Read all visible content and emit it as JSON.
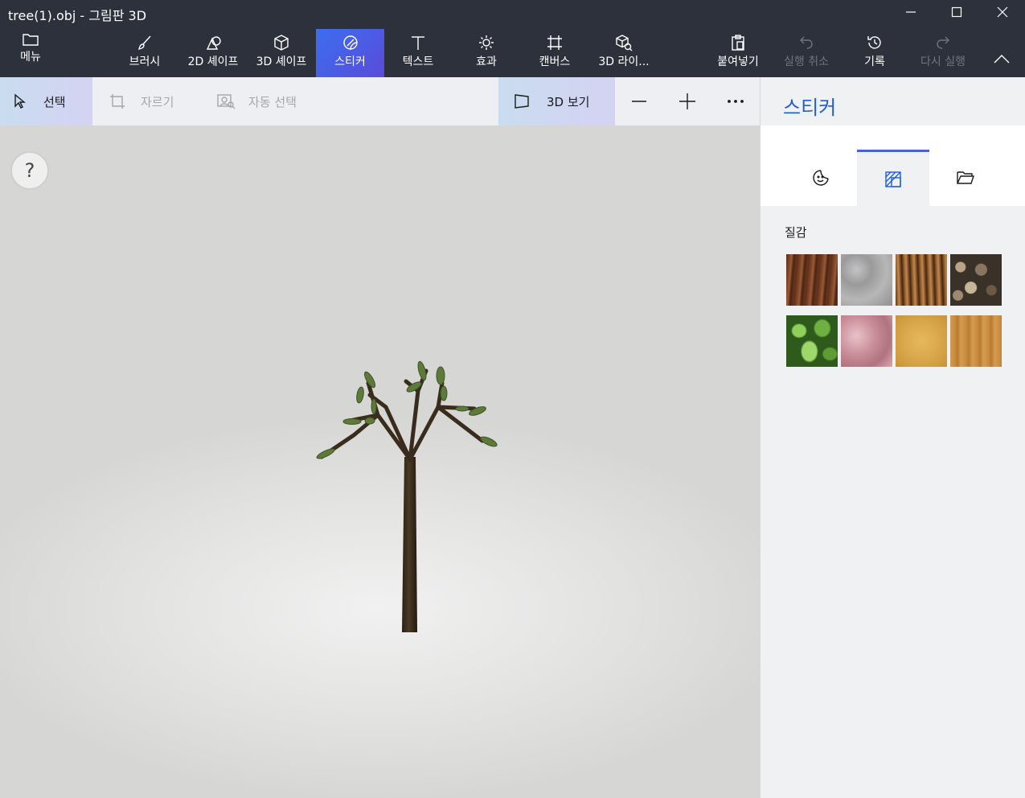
{
  "window": {
    "title": "tree(1).obj - 그림판 3D"
  },
  "ribbon": {
    "menu": "메뉴",
    "brush": "브러시",
    "shapes2d": "2D 셰이프",
    "shapes3d": "3D 셰이프",
    "stickers": "스티커",
    "text": "텍스트",
    "effects": "효과",
    "canvas": "캔버스",
    "library3d": "3D 라이...",
    "paste": "붙여넣기",
    "undo": "실행 취소",
    "history": "기록",
    "redo": "다시 실행"
  },
  "toolbar": {
    "select": "선택",
    "crop": "자르기",
    "magic_select": "자동 선택",
    "view3d": "3D 보기"
  },
  "panel": {
    "title": "스티커",
    "section": "질감",
    "textures": [
      {
        "name": "bark-texture",
        "color": "#6b3a24"
      },
      {
        "name": "granite-texture",
        "color": "#a6a6a6"
      },
      {
        "name": "hair-texture",
        "color": "#8a5a2e"
      },
      {
        "name": "pebbles-texture",
        "color": "#7d6a55"
      },
      {
        "name": "leaves-texture",
        "color": "#3f8a2a"
      },
      {
        "name": "marble-texture",
        "color": "#c98e9a"
      },
      {
        "name": "sand-texture",
        "color": "#d9a84c"
      },
      {
        "name": "wood-texture",
        "color": "#c98b3e"
      }
    ]
  },
  "help": "?",
  "accent": "#1d5fd6"
}
